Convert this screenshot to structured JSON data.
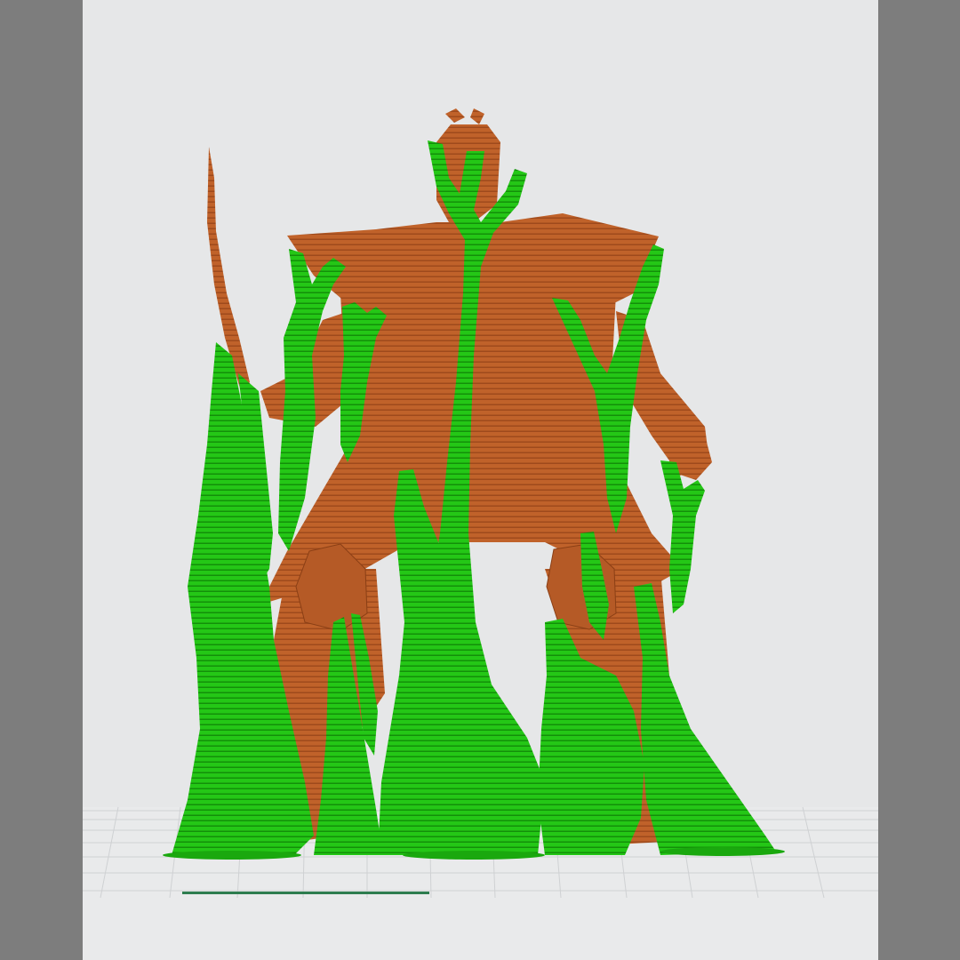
{
  "app": {
    "view": "layer-preview"
  },
  "colors": {
    "frame": "#7d7d7d",
    "viewport_bg": "#e6e7e8",
    "model": "#c0622a",
    "model_dark": "#9e4a1c",
    "support": "#22c414",
    "support_dark": "#159a0b",
    "bed_grid": "#c9cbcd",
    "progress_bar": "#2e7d4f"
  },
  "icons": {
    "model": "figure-model-icon",
    "supports": "tree-support-icon",
    "build_plate": "build-plate-grid-icon"
  },
  "layer_progress": {
    "fraction": 0.35
  }
}
